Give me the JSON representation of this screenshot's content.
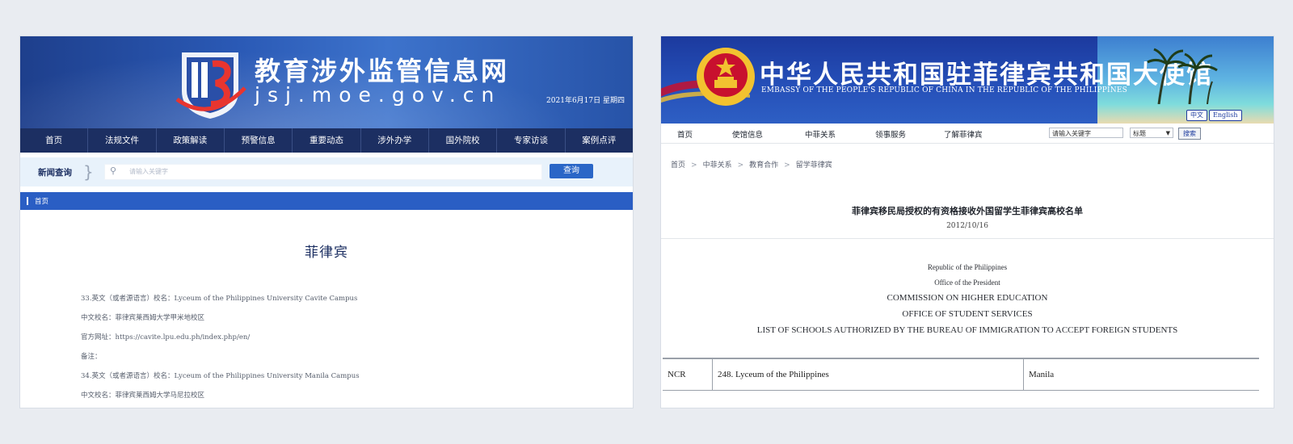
{
  "left": {
    "site_title": "教育涉外监管信息网",
    "site_domain": "jsj.moe.gov.cn",
    "date": "2021年6月17日 星期四",
    "nav": [
      "首页",
      "法规文件",
      "政策解读",
      "预警信息",
      "重要动态",
      "涉外办学",
      "国外院校",
      "专家访谈",
      "案例点评"
    ],
    "search": {
      "label": "新闻查询",
      "placeholder": "请输入关键字",
      "button": "查询"
    },
    "breadcrumb": "首页",
    "page_title": "菲律宾",
    "content": [
      "33.英文（或者源语言）校名：Lyceum of the Philippines University Cavite Campus",
      "中文校名：菲律宾莱西姆大学甲米地校区",
      "官方网址：https://cavite.lpu.edu.ph/index.php/en/",
      "备注：",
      "34.英文（或者源语言）校名：Lyceum of the Philippines University Manila Campus",
      "中文校名：菲律宾莱西姆大学马尼拉校区"
    ]
  },
  "right": {
    "site_title": "中华人民共和国驻菲律宾共和国大使馆",
    "site_subtitle": "EMBASSY OF THE PEOPLE'S REPUBLIC OF CHINA IN THE REPUBLIC OF THE PHILIPPINES",
    "lang_buttons": [
      "中文",
      "English"
    ],
    "nav": [
      "首页",
      "使馆信息",
      "中菲关系",
      "领事服务",
      "了解菲律宾"
    ],
    "search": {
      "input": "请输入关键字",
      "select": "标题",
      "button": "搜索"
    },
    "breadcrumb": [
      "首页",
      "中菲关系",
      "教育合作",
      "留学菲律宾"
    ],
    "doc_title": "菲律宾移民局授权的有资格接收外国留学生菲律宾高校名单",
    "doc_date": "2012/10/16",
    "letterhead": [
      "Republic of the Philippines",
      "Office of the President",
      "COMMISSION ON HIGHER EDUCATION",
      "OFFICE OF STUDENT SERVICES",
      "LIST OF SCHOOLS AUTHORIZED BY THE BUREAU OF IMMIGRATION TO ACCEPT FOREIGN STUDENTS"
    ],
    "table_row": {
      "region": "NCR",
      "school": "248. Lyceum of the Philippines",
      "city": "Manila"
    }
  },
  "colors": {
    "moe_blue": "#2a59b5",
    "moe_nav": "#1c2f62",
    "embassy_blue": "#1c3a9e",
    "emblem_red": "#c8102e",
    "emblem_gold": "#f2c230"
  }
}
